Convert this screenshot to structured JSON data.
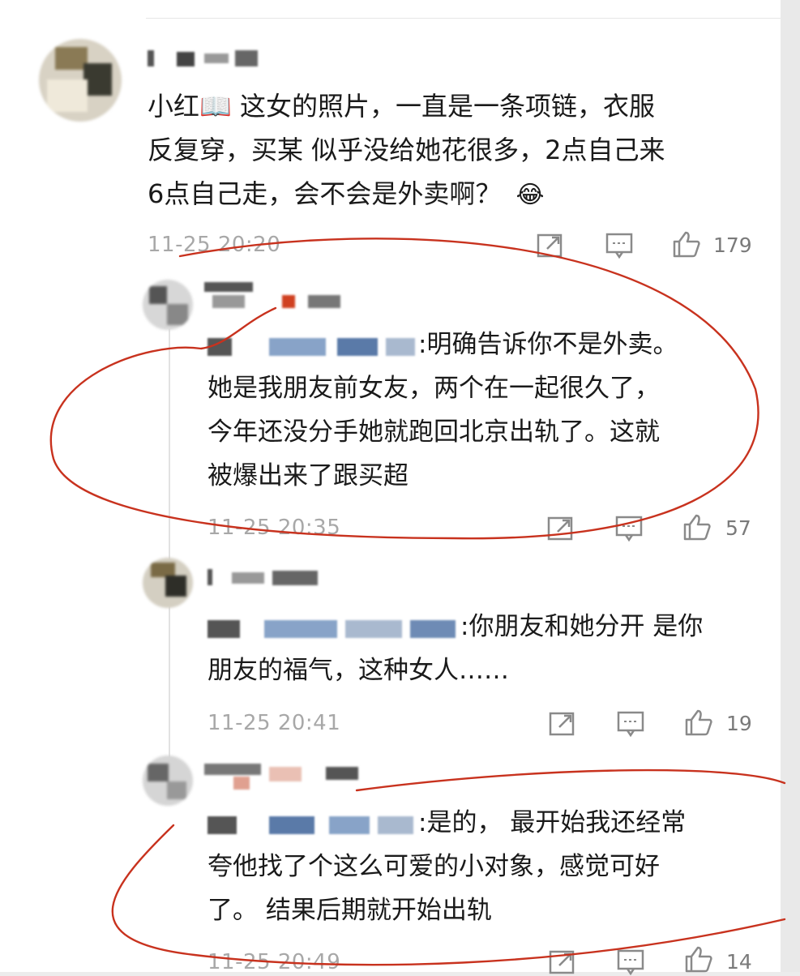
{
  "comments": [
    {
      "text_lines": [
        "小红📖 这女的照片，一直是一条项链，衣服",
        "反复穿，买某 似乎没给她花很多，2点自己来",
        "6点自己走，会不会是外卖啊？"
      ],
      "emoji": "😂",
      "time": "11-25 20:20",
      "likes": "179"
    }
  ],
  "replies": [
    {
      "text_after_mention": ":明确告诉你不是外卖。",
      "text_lines": [
        "她是我朋友前女友，两个在一起很久了，",
        "今年还没分手她就跑回北京出轨了。这就",
        "被爆出来了跟买超"
      ],
      "time": "11-25 20:35",
      "likes": "57"
    },
    {
      "text_after_mention": ":你朋友和她分开 是你",
      "text_lines": [
        "朋友的福气，这种女人……"
      ],
      "time": "11-25 20:41",
      "likes": "19"
    },
    {
      "text_after_mention": ":是的， 最开始我还经常",
      "text_lines": [
        "夸他找了个这么可爱的小对象，感觉可好",
        "了。 结果后期就开始出轨"
      ],
      "time": "11-25 20:49",
      "likes": "14"
    }
  ],
  "icons": [
    "share-icon",
    "comment-icon",
    "thumb-up-icon"
  ],
  "colors": {
    "annotation": "#c8321e",
    "timestamp": "#a8a8a8",
    "divider": "#e2e2e2"
  }
}
